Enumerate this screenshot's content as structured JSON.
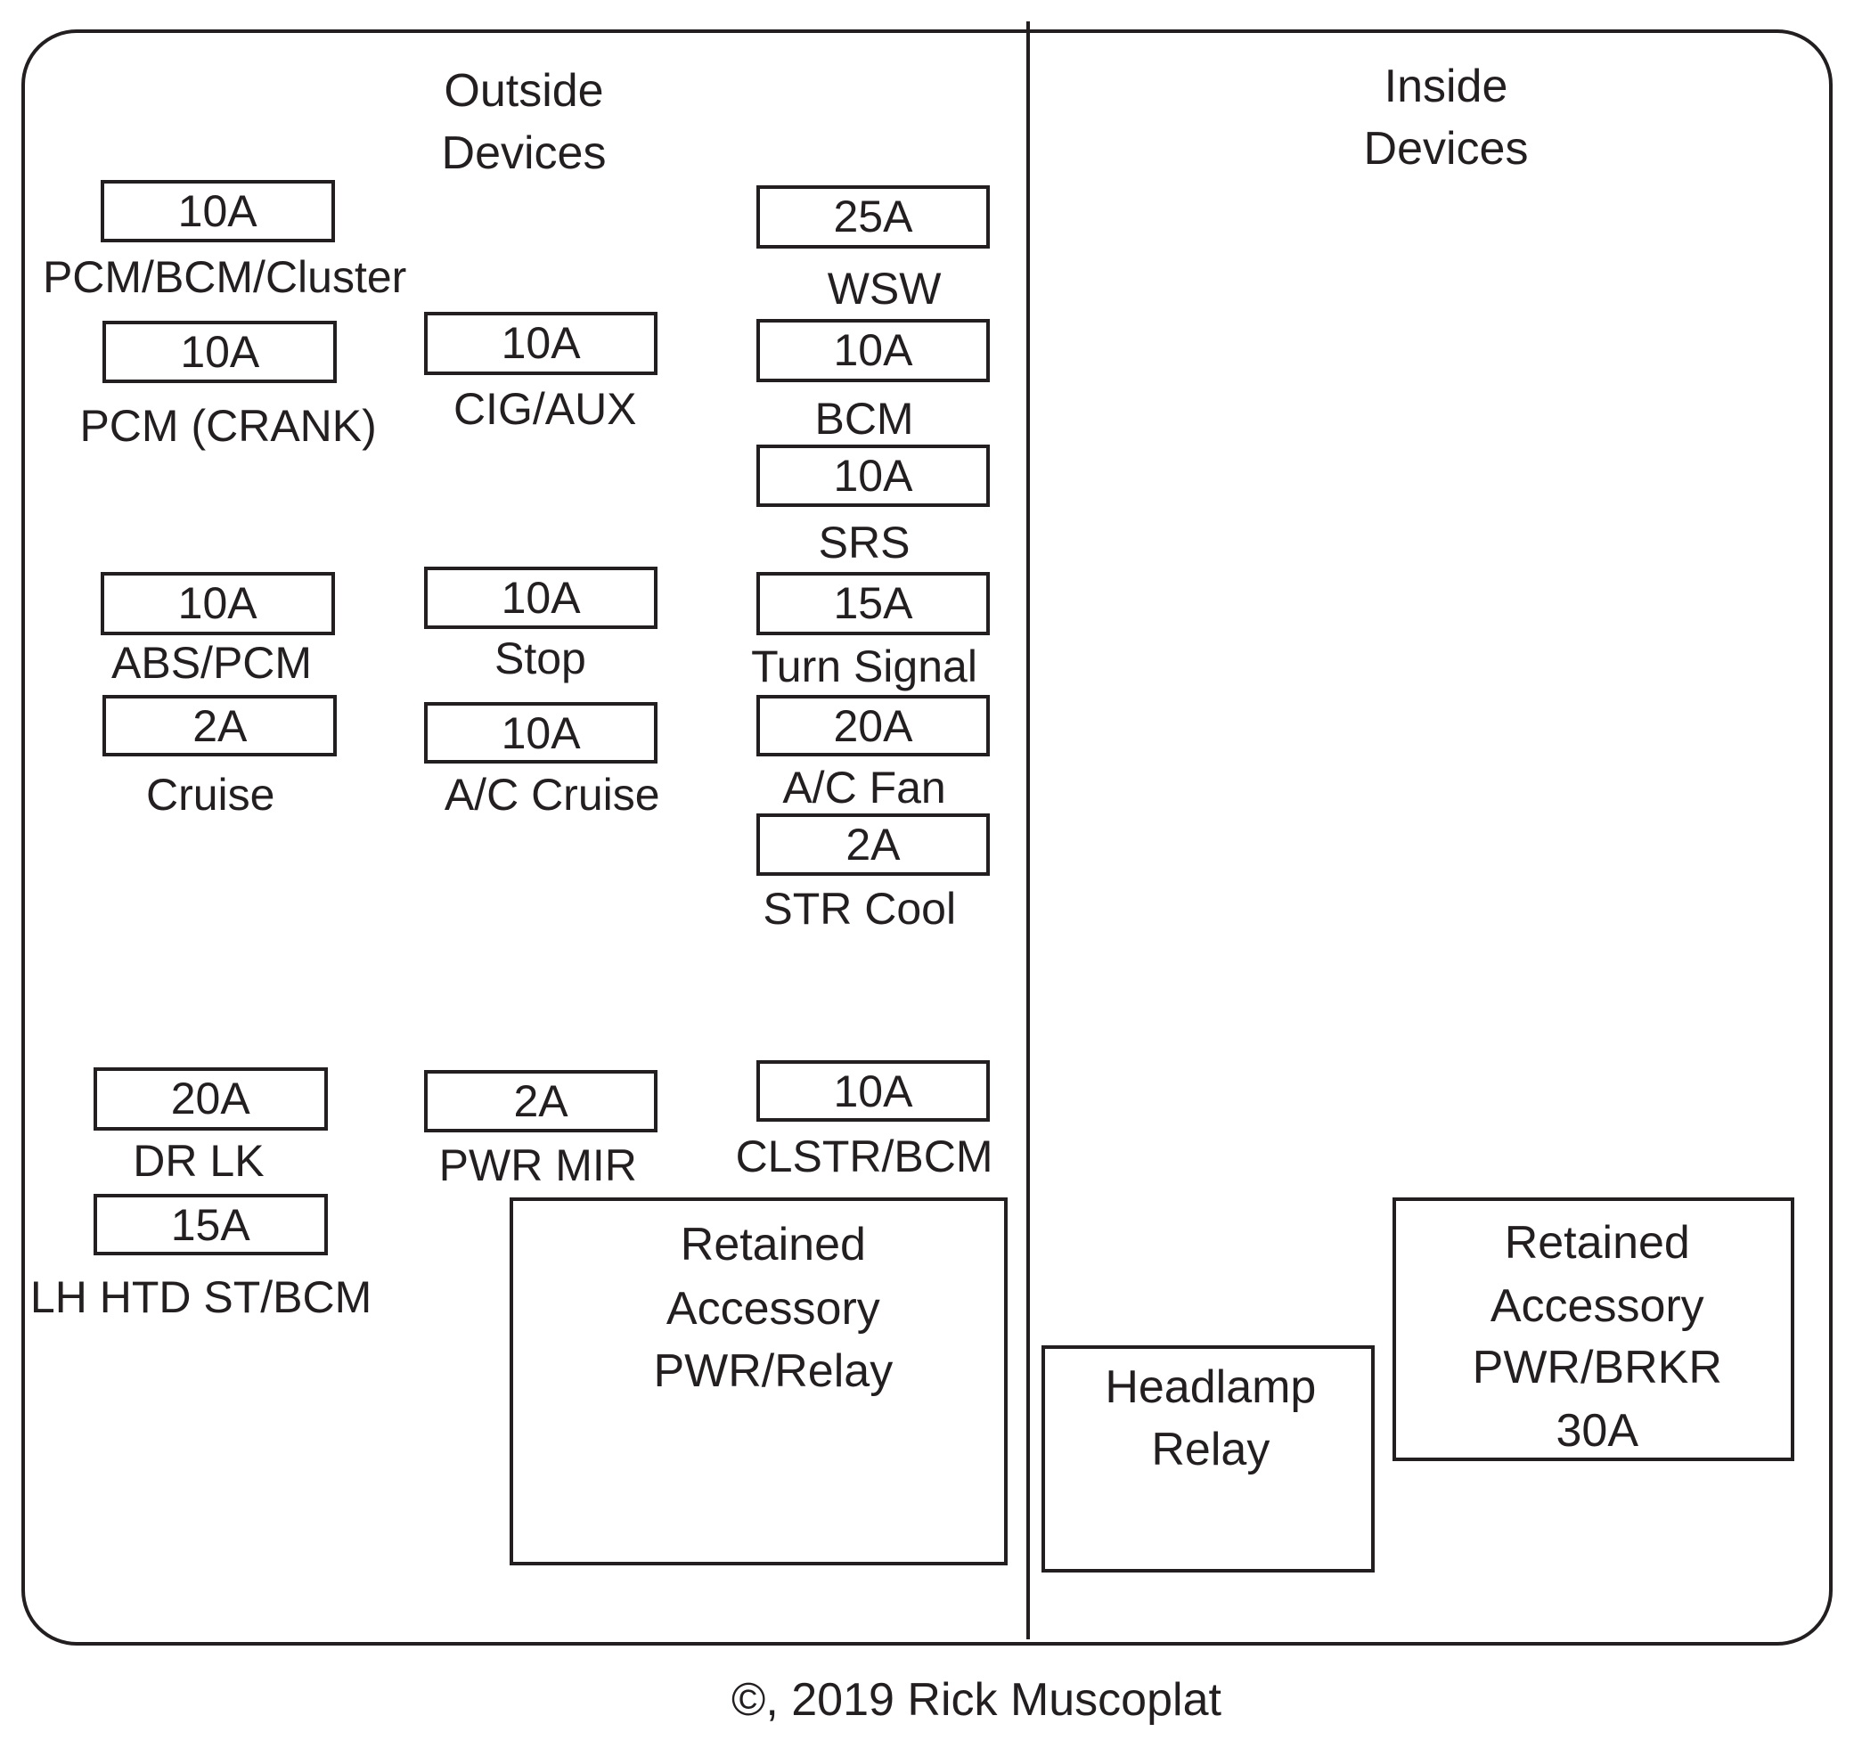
{
  "sections": {
    "outside": {
      "line1": "Outside",
      "line2": "Devices"
    },
    "inside": {
      "line1": "Inside",
      "line2": "Devices"
    }
  },
  "fuses": [
    {
      "rating": "10A",
      "label": "PCM/BCM/Cluster"
    },
    {
      "rating": "10A",
      "label": "PCM (CRANK)"
    },
    {
      "rating": "10A",
      "label": "CIG/AUX"
    },
    {
      "rating": "25A",
      "label": "WSW"
    },
    {
      "rating": "10A",
      "label": "BCM"
    },
    {
      "rating": "10A",
      "label": "SRS"
    },
    {
      "rating": "15A",
      "label": "Turn Signal"
    },
    {
      "rating": "20A",
      "label": "A/C Fan"
    },
    {
      "rating": "2A",
      "label": "STR Cool"
    },
    {
      "rating": "10A",
      "label": "ABS/PCM"
    },
    {
      "rating": "2A",
      "label": "Cruise"
    },
    {
      "rating": "10A",
      "label": "Stop"
    },
    {
      "rating": "10A",
      "label": "A/C Cruise"
    },
    {
      "rating": "20A",
      "label": "DR LK"
    },
    {
      "rating": "15A",
      "label": "LH HTD ST/BCM"
    },
    {
      "rating": "2A",
      "label": "PWR MIR"
    },
    {
      "rating": "10A",
      "label": "CLSTR/BCM"
    }
  ],
  "blocks": [
    {
      "name": "retained-accessory-relay",
      "lines": [
        "Retained",
        "Accessory",
        "PWR/Relay"
      ]
    },
    {
      "name": "headlamp-relay",
      "lines": [
        "Headlamp",
        "Relay"
      ]
    },
    {
      "name": "retained-accessory-breaker",
      "lines": [
        "Retained",
        "Accessory",
        "PWR/BRKR",
        "30A"
      ]
    }
  ],
  "copyright": "©, 2019 Rick Muscoplat"
}
